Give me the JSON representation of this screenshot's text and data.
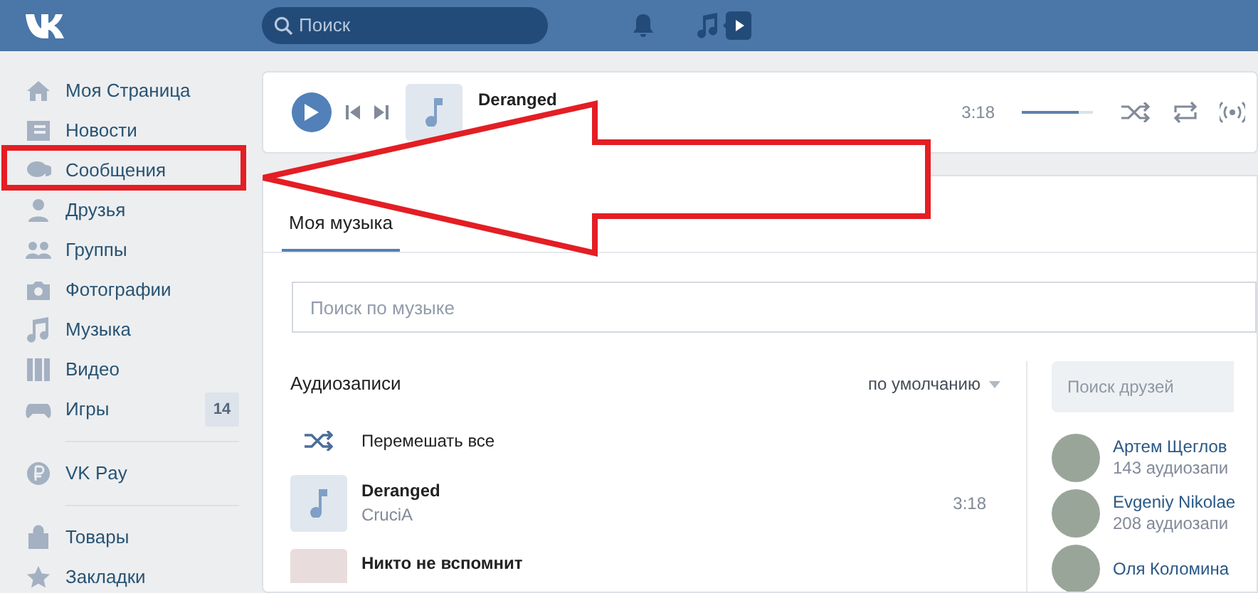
{
  "header": {
    "search_placeholder": "Поиск"
  },
  "sidebar": {
    "sections": [
      [
        {
          "label": "Моя Страница",
          "highlighted": false
        },
        {
          "label": "Новости",
          "highlighted": false
        },
        {
          "label": "Сообщения",
          "highlighted": true
        },
        {
          "label": "Друзья",
          "highlighted": false
        },
        {
          "label": "Группы",
          "highlighted": false
        },
        {
          "label": "Фотографии",
          "highlighted": false
        },
        {
          "label": "Музыка",
          "highlighted": false
        },
        {
          "label": "Видео",
          "highlighted": false
        },
        {
          "label": "Игры",
          "highlighted": false,
          "badge": "14"
        }
      ],
      [
        {
          "label": "VK Pay",
          "highlighted": false
        }
      ],
      [
        {
          "label": "Товары",
          "highlighted": false
        },
        {
          "label": "Закладки",
          "highlighted": false
        }
      ]
    ]
  },
  "player": {
    "title": "Deranged",
    "time": "3:18",
    "volume": {
      "level": 0.8
    }
  },
  "tabs": [
    {
      "label": "Моя музыка",
      "selected": true
    }
  ],
  "music_search": {
    "placeholder": "Поиск по музыке"
  },
  "audio": {
    "title": "Аудиозаписи",
    "sort": "по умолчанию",
    "shuffle": "Перемешать все",
    "tracks": [
      {
        "title": "Deranged",
        "artist": "CruciA",
        "duration": "3:18",
        "kind": "note"
      },
      {
        "title": "Никто не вспомнит",
        "kind": "photo"
      }
    ]
  },
  "friends": {
    "placeholder": "Поиск друзей",
    "list": [
      {
        "name": "Артем Щеглов",
        "count": "143 аудиозапи"
      },
      {
        "name": "Evgeniy Nikolae",
        "count": "208 аудиозапи"
      },
      {
        "name": "Оля Коломина"
      }
    ]
  }
}
